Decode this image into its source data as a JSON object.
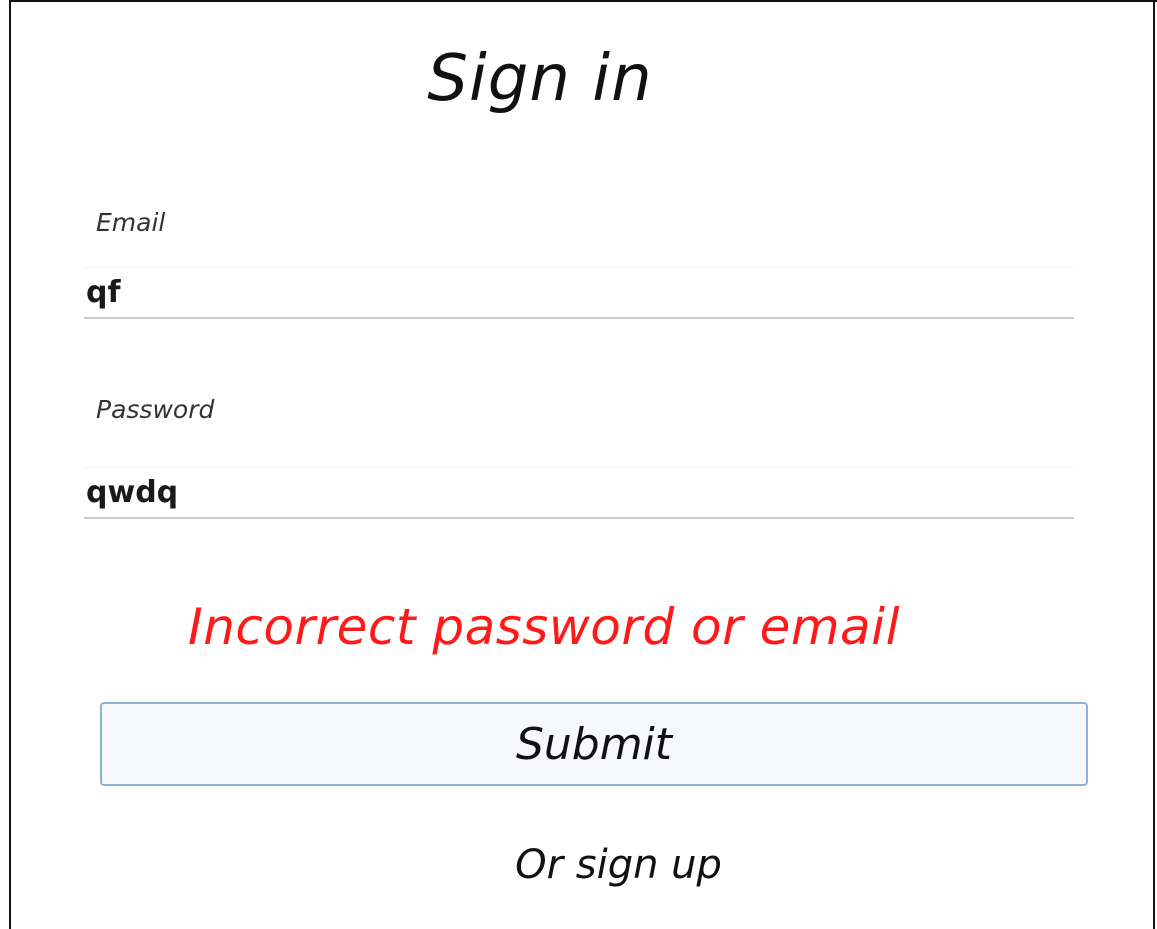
{
  "page": {
    "title": "Sign in"
  },
  "form": {
    "email": {
      "label": "Email",
      "value": "qf"
    },
    "password": {
      "label": "Password",
      "value": "qwdq"
    },
    "error_message": "Incorrect password or email",
    "submit_label": "Submit",
    "signup_link": "Or sign up"
  },
  "colors": {
    "error": "#ff1a1a",
    "button_border": "#8fb2d6",
    "button_background": "#f6f8fb",
    "input_underline": "#c9ccd1"
  }
}
